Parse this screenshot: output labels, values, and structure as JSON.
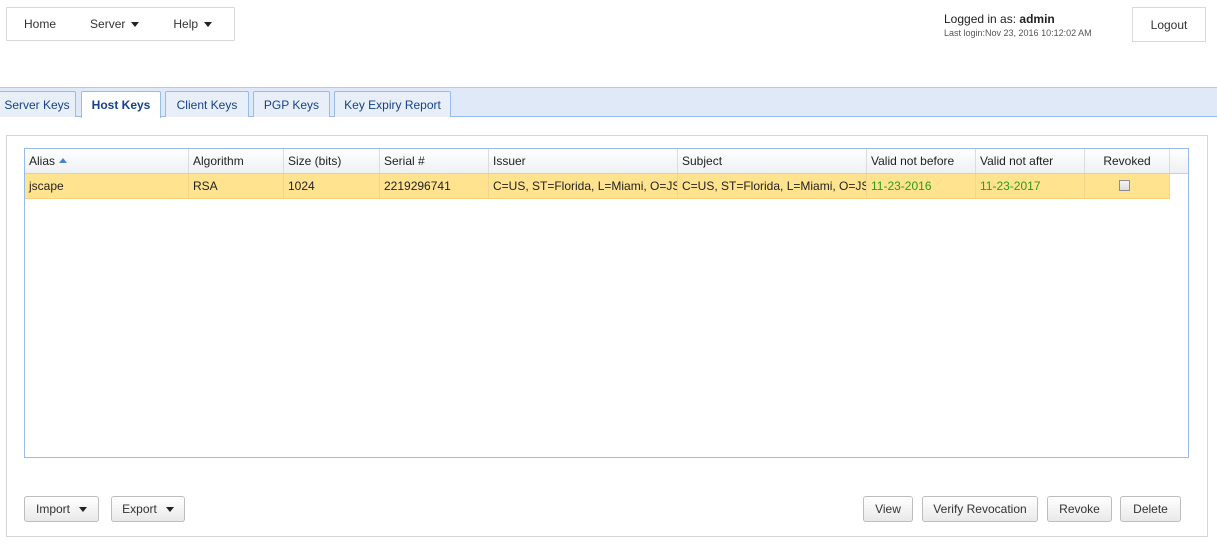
{
  "nav": {
    "home": "Home",
    "server": "Server",
    "help": "Help"
  },
  "user": {
    "logged_in_label": "Logged in as:",
    "username": "admin",
    "last_login": "Last login:Nov 23, 2016 10:12:02 AM",
    "logout": "Logout"
  },
  "tabs": [
    {
      "label": "Server Keys",
      "active": false
    },
    {
      "label": "Host Keys",
      "active": true
    },
    {
      "label": "Client Keys",
      "active": false
    },
    {
      "label": "PGP Keys",
      "active": false
    },
    {
      "label": "Key Expiry Report",
      "active": false
    }
  ],
  "table": {
    "columns": [
      "Alias",
      "Algorithm",
      "Size (bits)",
      "Serial #",
      "Issuer",
      "Subject",
      "Valid not before",
      "Valid not after",
      "Revoked"
    ],
    "sort_column": "Alias",
    "sort_direction": "ascending",
    "rows": [
      {
        "alias": "jscape",
        "algorithm": "RSA",
        "size": "1024",
        "serial": "2219296741",
        "issuer": "C=US, ST=Florida, L=Miami, O=JSCAPE",
        "subject": "C=US, ST=Florida, L=Miami, O=JSCAPE",
        "valid_not_before": "11-23-2016",
        "valid_not_after": "11-23-2017",
        "revoked": false
      }
    ]
  },
  "buttons": {
    "import": "Import",
    "export": "Export",
    "view": "View",
    "verify_revocation": "Verify Revocation",
    "revoke": "Revoke",
    "delete": "Delete"
  },
  "colors": {
    "selected_row": "#ffe38f",
    "tab_bar": "#dfe9f7",
    "date_text": "#2f9b13"
  }
}
